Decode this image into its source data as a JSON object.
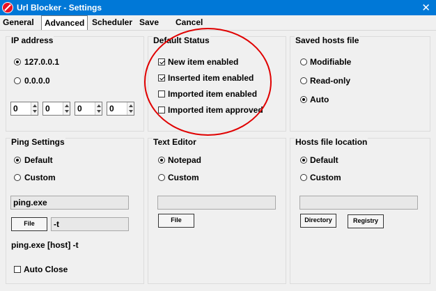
{
  "window": {
    "title": "Url Blocker - Settings",
    "close_glyph": "✕"
  },
  "menu": [
    {
      "label": "General"
    },
    {
      "label": "Advanced"
    },
    {
      "label": "Scheduler"
    },
    {
      "label": "Save"
    },
    {
      "label": "Cancel"
    }
  ],
  "ip_address": {
    "title": "IP address",
    "options": [
      {
        "label": "127.0.0.1",
        "selected": true
      },
      {
        "label": "0.0.0.0",
        "selected": false
      }
    ],
    "octets": [
      "0",
      "0",
      "0",
      "0"
    ]
  },
  "default_status": {
    "title": "Default Status",
    "items": [
      {
        "label": "New item enabled",
        "checked": true
      },
      {
        "label": "Inserted item enabled",
        "checked": true
      },
      {
        "label": "Imported item enabled",
        "checked": false
      },
      {
        "label": "Imported item approved",
        "checked": false
      }
    ]
  },
  "saved_hosts": {
    "title": "Saved hosts file",
    "options": [
      {
        "label": "Modifiable",
        "selected": false
      },
      {
        "label": "Read-only",
        "selected": false
      },
      {
        "label": "Auto",
        "selected": true
      }
    ]
  },
  "ping": {
    "title": "Ping Settings",
    "options": [
      {
        "label": "Default",
        "selected": true
      },
      {
        "label": "Custom",
        "selected": false
      }
    ],
    "exe_value": "ping.exe",
    "file_button": "File",
    "args_value": "-t",
    "command_preview": "ping.exe [host] -t",
    "auto_close_label": "Auto Close",
    "auto_close_checked": false
  },
  "text_editor": {
    "title": "Text Editor",
    "options": [
      {
        "label": "Notepad",
        "selected": true
      },
      {
        "label": "Custom",
        "selected": false
      }
    ],
    "path_value": "",
    "file_button": "File"
  },
  "hosts_location": {
    "title": "Hosts file location",
    "options": [
      {
        "label": "Default",
        "selected": true
      },
      {
        "label": "Custom",
        "selected": false
      }
    ],
    "path_value": "",
    "directory_button": "Directory",
    "registry_button": "Registry"
  },
  "colors": {
    "titlebar": "#0078d7",
    "annotation": "#e00000"
  }
}
